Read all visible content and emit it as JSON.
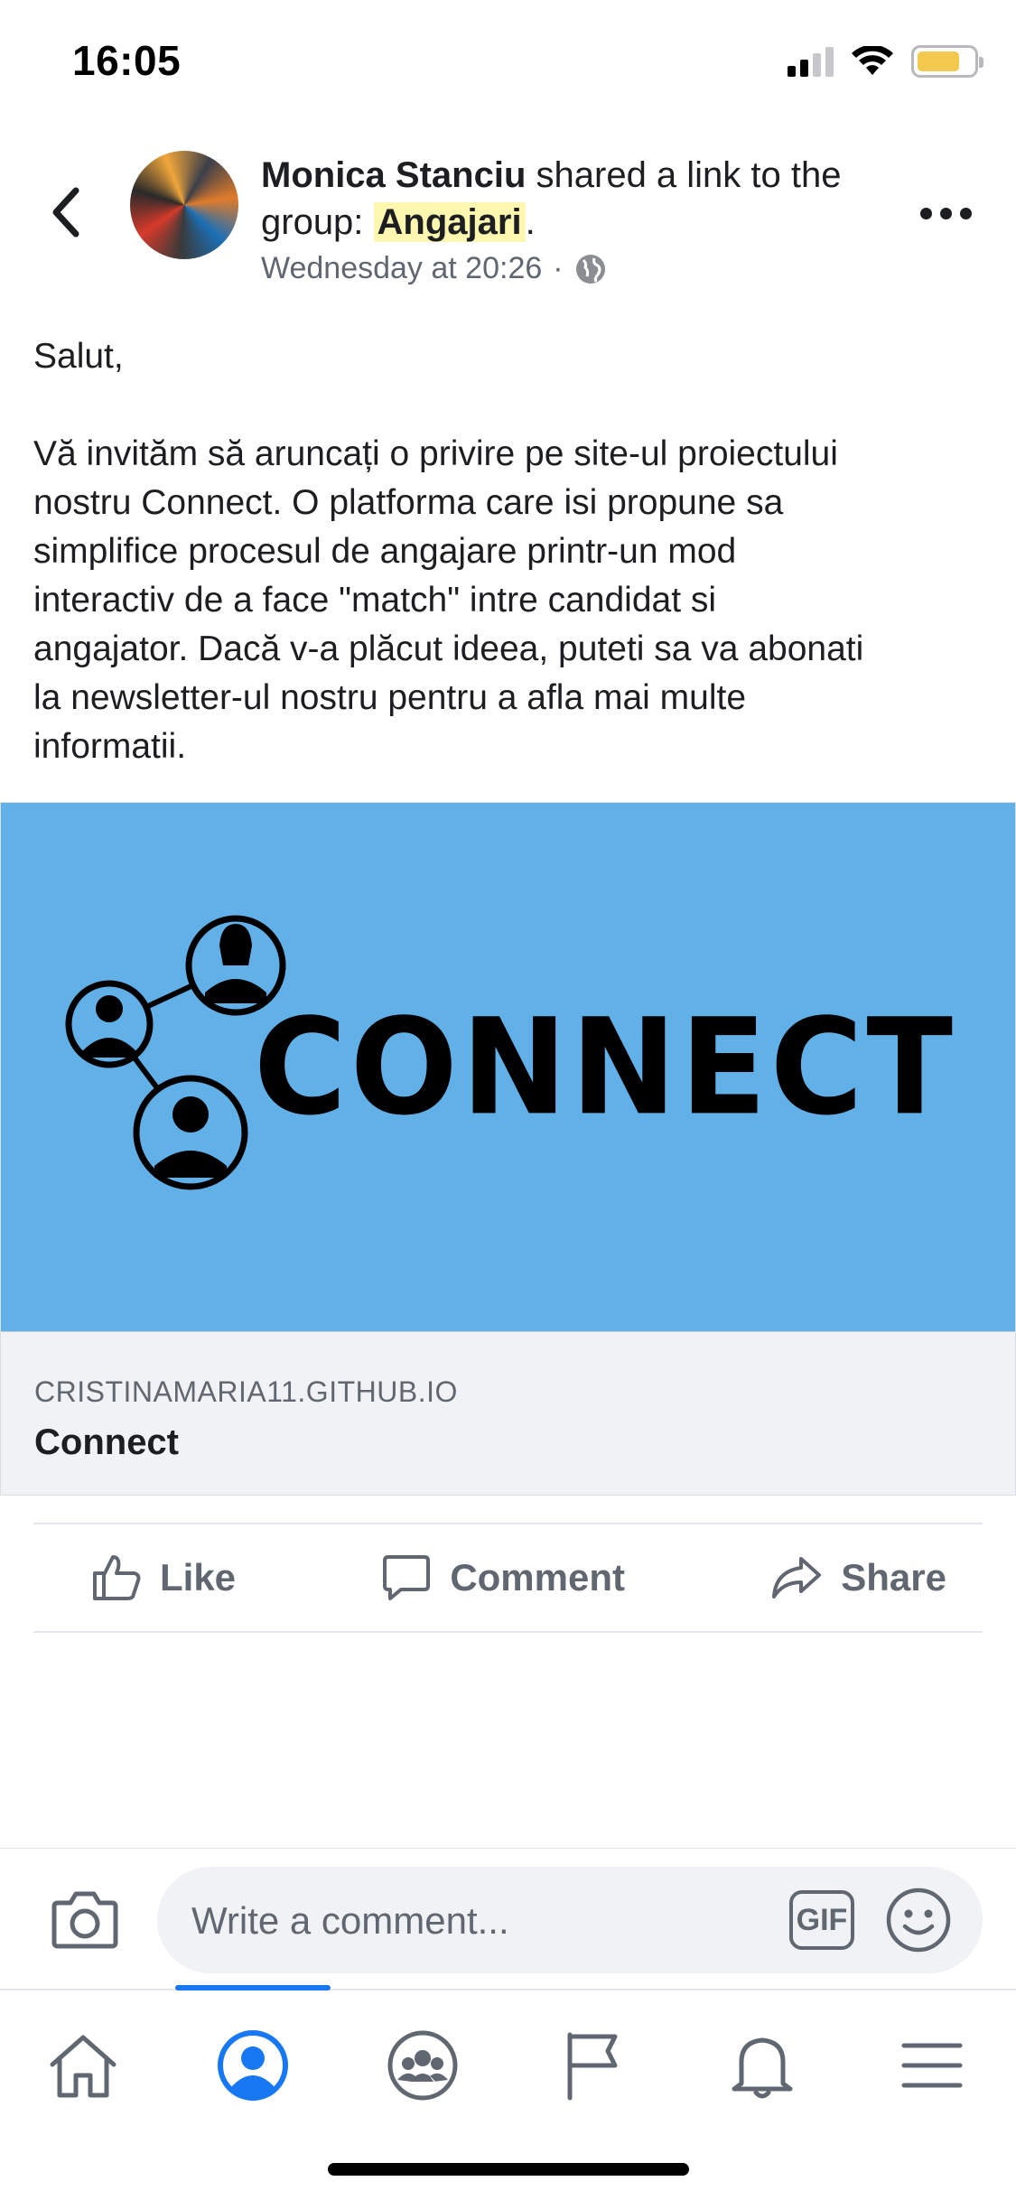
{
  "status_bar": {
    "time": "16:05"
  },
  "post": {
    "author": "Monica Stanciu",
    "action_text": " shared a link to the group: ",
    "group_name": "Angajari",
    "after_group": ".",
    "timestamp": "Wednesday at 20:26",
    "separator": "·",
    "privacy_icon": "globe-icon",
    "greeting": "Salut,",
    "body_lines": [
      "Vă invităm să aruncați o privire pe site-ul proiectului",
      "nostru Connect. O platforma care isi propune sa",
      "simplifice procesul de angajare printr-un mod",
      "interactiv de a face \"match\" intre candidat si",
      "angajator. Dacă v-a plăcut ideea, puteti sa va abonati",
      "la newsletter-ul nostru pentru a afla mai multe",
      "informatii."
    ]
  },
  "link_preview": {
    "image_wordmark": "CONNECT",
    "image_bg_color": "#62b0e8",
    "domain": "CRISTINAMARIA11.GITHUB.IO",
    "title": "Connect"
  },
  "actions": {
    "like": "Like",
    "comment": "Comment",
    "share": "Share"
  },
  "comment_bar": {
    "placeholder": "Write a comment...",
    "gif_label": "GIF"
  },
  "tab_bar": {
    "active_tab": "profile",
    "accent_color": "#1877f2",
    "tabs": [
      "home-icon",
      "profile-icon",
      "groups-icon",
      "pages-flag-icon",
      "notifications-bell-icon",
      "menu-icon"
    ]
  }
}
